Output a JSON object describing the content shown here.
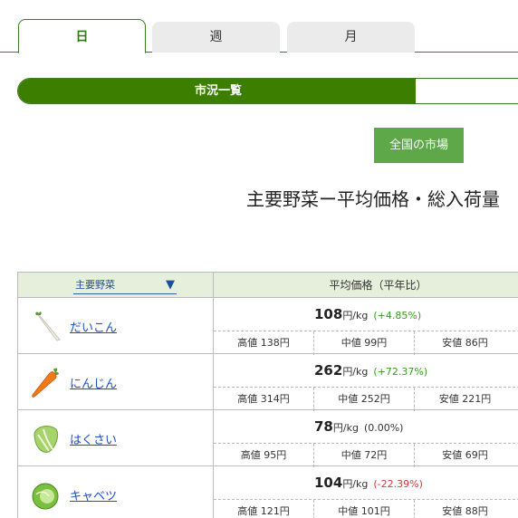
{
  "tabs": [
    {
      "label": "日",
      "active": true
    },
    {
      "label": "週",
      "active": false
    },
    {
      "label": "月",
      "active": false
    }
  ],
  "section_bar": {
    "label": "市況一覧",
    "progress": 0.76
  },
  "market_button": {
    "label": "全国の市場"
  },
  "page_title": "主要野菜ー平均価格・総入荷量",
  "table": {
    "sort_select_value": "主要野菜",
    "header_right": "平均価格（平年比）",
    "rows": [
      {
        "name": "だいこん",
        "icon": "daikon-icon",
        "avg": "108",
        "unit": "円/kg",
        "change": "(+4.85%)",
        "trend": "up",
        "high": "高値 138円",
        "mid": "中値 99円",
        "low": "安値 86円"
      },
      {
        "name": "にんじん",
        "icon": "carrot-icon",
        "avg": "262",
        "unit": "円/kg",
        "change": "(+72.37%)",
        "trend": "up",
        "high": "高値 314円",
        "mid": "中値 252円",
        "low": "安値 221円"
      },
      {
        "name": "はくさい",
        "icon": "napa-cabbage-icon",
        "avg": "78",
        "unit": "円/kg",
        "change": "(0.00%)",
        "trend": "flat",
        "high": "高値 95円",
        "mid": "中値 72円",
        "low": "安値 69円"
      },
      {
        "name": "キャベツ",
        "icon": "cabbage-icon",
        "avg": "104",
        "unit": "円/kg",
        "change": "(-22.39%)",
        "trend": "down",
        "high": "高値 121円",
        "mid": "中値 101円",
        "low": "安値 88円"
      }
    ]
  },
  "colors": {
    "accent": "#3c7e00",
    "button": "#5fa849",
    "up": "#3a9a20",
    "down": "#d23a3a",
    "link": "#1a4fc4"
  }
}
